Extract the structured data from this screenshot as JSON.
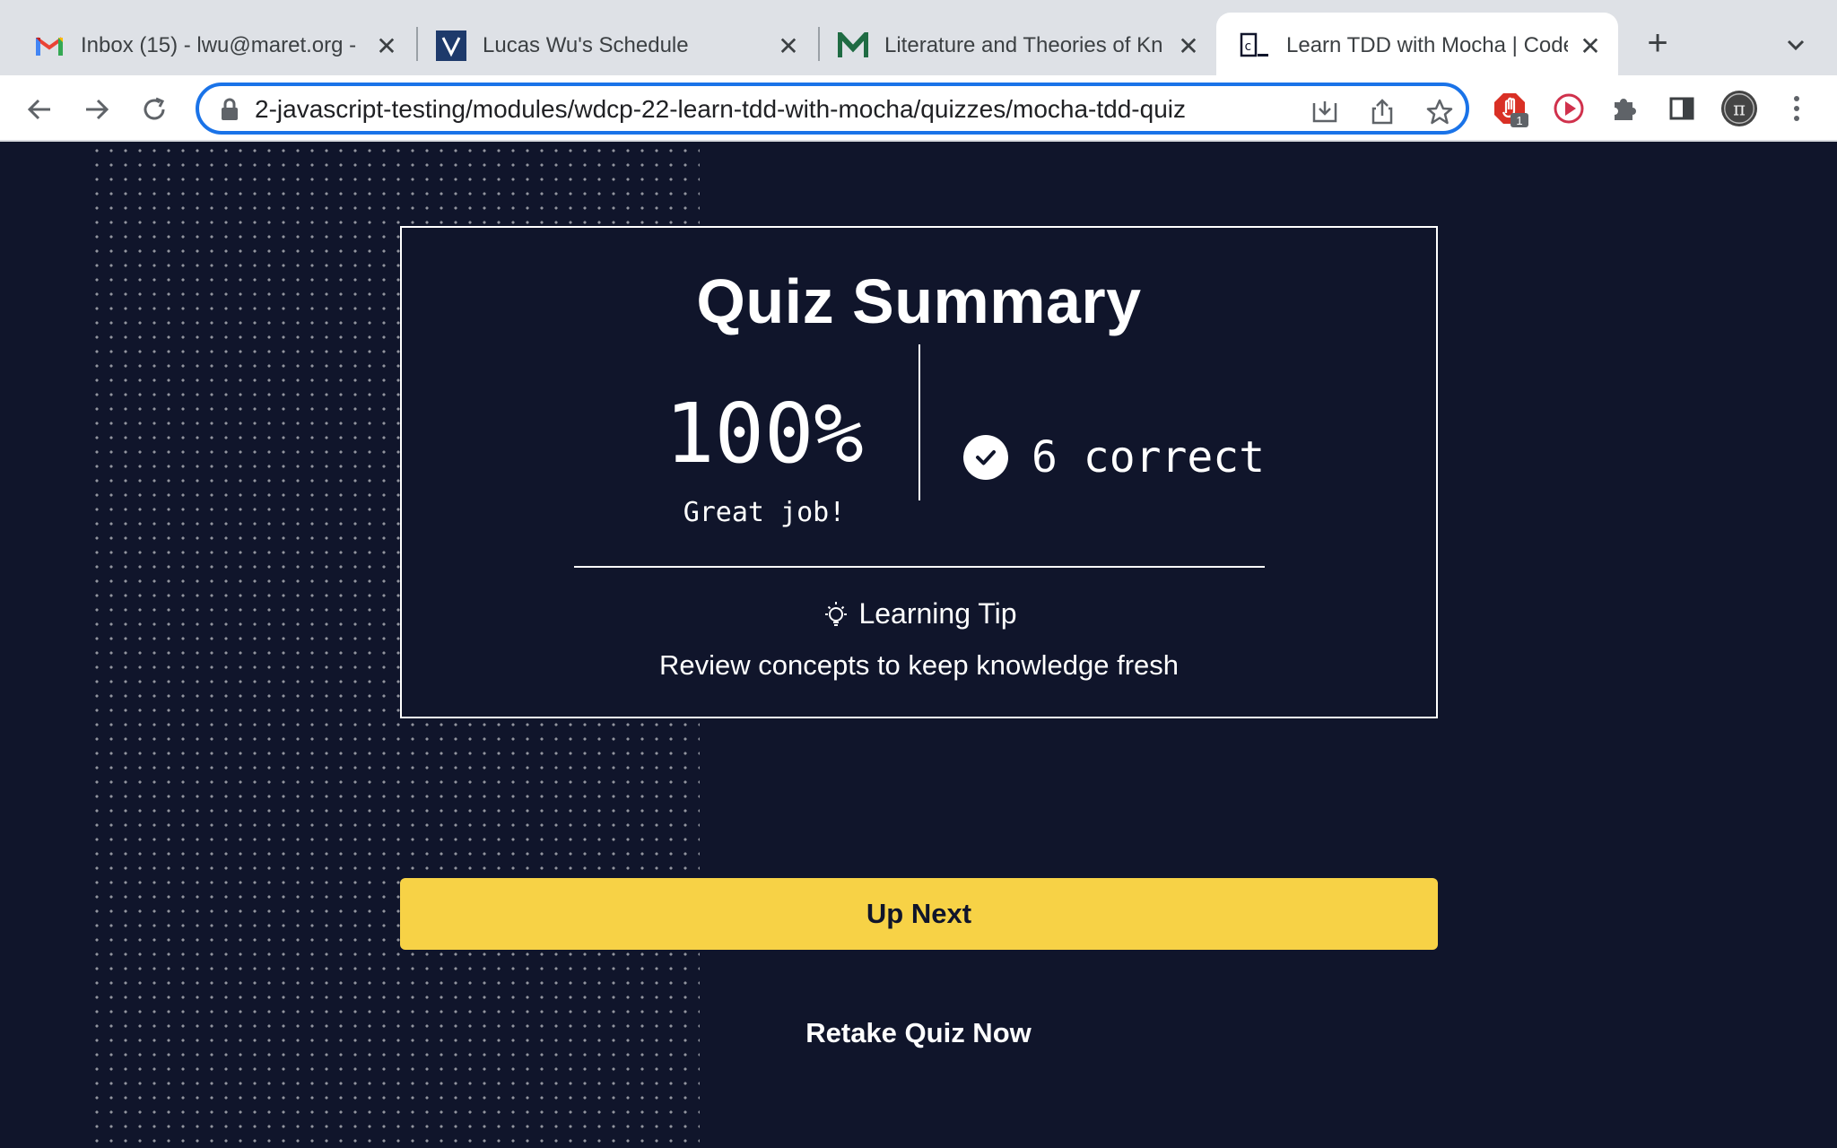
{
  "browser": {
    "tabs": [
      {
        "title": "Inbox (15) - lwu@maret.org - ",
        "favicon": "gmail-icon"
      },
      {
        "title": "Lucas Wu's Schedule",
        "favicon": "veracross-icon"
      },
      {
        "title": "Literature and Theories of Kn",
        "favicon": "moodle-icon"
      },
      {
        "title": "Learn TDD with Mocha | Code",
        "favicon": "codecademy-icon",
        "active": true
      }
    ],
    "new_tab": "+",
    "url": "2-javascript-testing/modules/wdcp-22-learn-tdd-with-mocha/quizzes/mocha-tdd-quiz",
    "extension_badge": "1",
    "accent_color": "#1a73e8"
  },
  "quiz_summary": {
    "heading": "Quiz Summary",
    "score": "100%",
    "praise": "Great job!",
    "correct": "6 correct",
    "tip_label": "Learning Tip",
    "tip_text": "Review concepts to keep knowledge fresh"
  },
  "actions": {
    "up_next": "Up Next",
    "retake": "Retake Quiz Now"
  },
  "colors": {
    "page_bg": "#10152b",
    "primary_button": "#f7d246"
  }
}
